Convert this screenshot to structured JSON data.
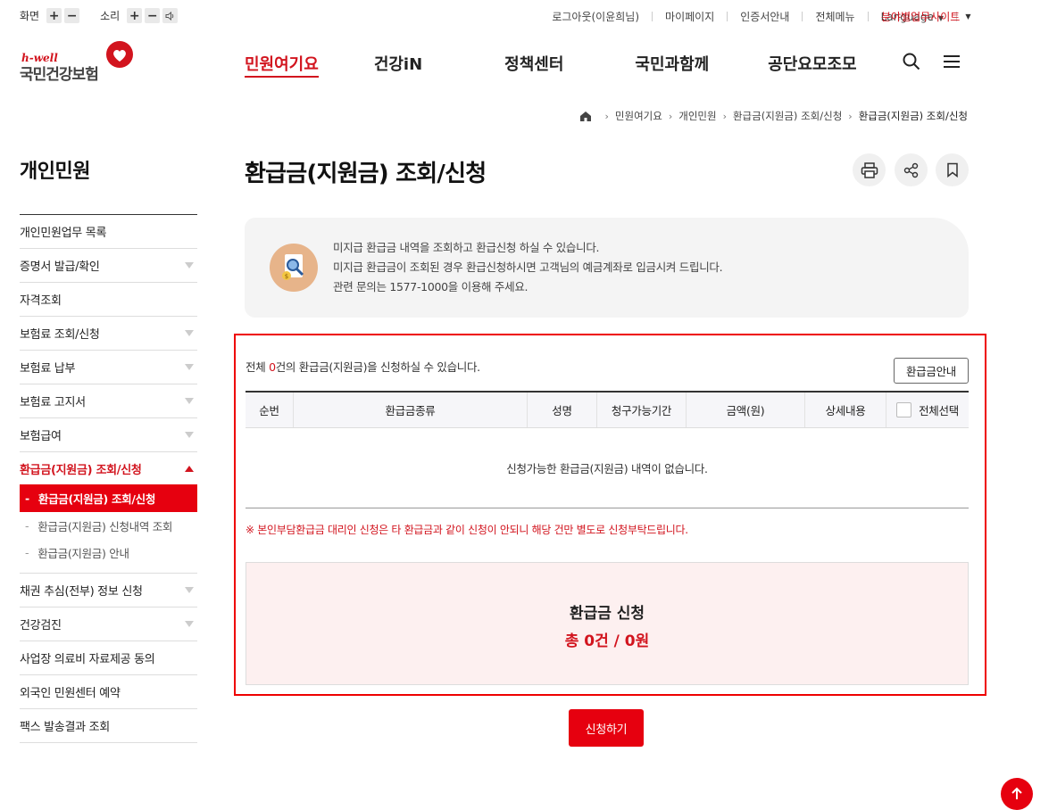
{
  "util": {
    "screen_label": "화면",
    "sound_label": "소리",
    "plus": "+",
    "minus": "−",
    "links": [
      "로그아웃(이윤희님)",
      "마이페이지",
      "인증서안내",
      "전체메뉴",
      "Language"
    ],
    "site_label": "분야별업무사이트"
  },
  "logo": {
    "brand": "h-well",
    "name": "국민건강보험"
  },
  "gnb": [
    "민원여기요",
    "건강iN",
    "정책센터",
    "국민과함께",
    "공단요모조모"
  ],
  "breadcrumb": [
    "민원여기요",
    "개인민원",
    "환급금(지원금) 조회/신청",
    "환급금(지원금) 조회/신청"
  ],
  "sidebar": {
    "title": "개인민원",
    "items_top": [
      {
        "label": "개인민원업무 목록",
        "arrow": false
      },
      {
        "label": "증명서 발급/확인",
        "arrow": true
      },
      {
        "label": "자격조회",
        "arrow": false
      },
      {
        "label": "보험료 조회/신청",
        "arrow": true
      },
      {
        "label": "보험료 납부",
        "arrow": true
      },
      {
        "label": "보험료 고지서",
        "arrow": true
      },
      {
        "label": "보험급여",
        "arrow": true
      }
    ],
    "open_item": "환급금(지원금) 조회/신청",
    "sub_items": [
      "환급금(지원금) 조회/신청",
      "환급금(지원금) 신청내역 조회",
      "환급금(지원금) 안내"
    ],
    "items_bottom": [
      {
        "label": "채권 추심(전부) 정보 신청",
        "arrow": true
      },
      {
        "label": "건강검진",
        "arrow": true
      },
      {
        "label": "사업장 의료비 자료제공 동의",
        "arrow": false
      },
      {
        "label": "외국인 민원센터 예약",
        "arrow": false
      },
      {
        "label": "팩스 발송결과 조회",
        "arrow": false
      }
    ]
  },
  "page": {
    "title": "환급금(지원금) 조회/신청",
    "info_lines": [
      "미지급 환급금 내역을 조회하고 환급신청 하실 수 있습니다.",
      "미지급 환급금이 조회된 경우 환급신청하시면 고객님의 예금계좌로 입금시켜 드립니다.",
      "관련 문의는 1577-1000을 이용해 주세요."
    ],
    "avail_prefix": "전체 ",
    "avail_count": "0",
    "avail_suffix": "건의 환급금(지원금)을 신청하실 수 있습니다.",
    "guide_button": "환급금안내",
    "table_headers": [
      "순번",
      "환급금종류",
      "성명",
      "청구가능기간",
      "금액(원)",
      "상세내용",
      "전체선택"
    ],
    "empty_message": "신청가능한 환급금(지원금) 내역이 없습니다.",
    "notice": "※ 본인부담환급금 대리인 신청은 타 환급금과 같이 신청이 안되니 해당 건만 별도로 신청부탁드립니다.",
    "summary_title": "환급금 신청",
    "summary_value": "총 0건 / 0원",
    "apply_button": "신청하기"
  },
  "colors": {
    "accent": "#e6000f",
    "brand_red": "#d2141e"
  },
  "icons": [
    "home-icon",
    "search-icon",
    "menu-icon",
    "print-icon",
    "share-icon",
    "bookmark-icon",
    "refund-search-icon",
    "arrow-up-icon"
  ]
}
